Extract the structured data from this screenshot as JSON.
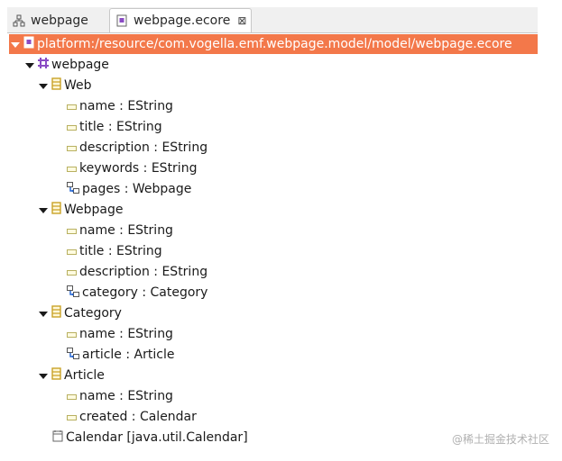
{
  "tabs": [
    {
      "label": "webpage"
    },
    {
      "label": "webpage.ecore",
      "close": "⊠"
    }
  ],
  "tree": {
    "root_path": "platform:/resource/com.vogella.emf.webpage.model/model/webpage.ecore",
    "package": "webpage",
    "classes": [
      {
        "name": "Web",
        "features": [
          {
            "label": "name : EString",
            "kind": "attribute"
          },
          {
            "label": "title : EString",
            "kind": "attribute"
          },
          {
            "label": "description : EString",
            "kind": "attribute"
          },
          {
            "label": "keywords : EString",
            "kind": "attribute"
          },
          {
            "label": "pages : Webpage",
            "kind": "reference"
          }
        ]
      },
      {
        "name": "Webpage",
        "features": [
          {
            "label": "name : EString",
            "kind": "attribute"
          },
          {
            "label": "title : EString",
            "kind": "attribute"
          },
          {
            "label": "description : EString",
            "kind": "attribute"
          },
          {
            "label": "category : Category",
            "kind": "reference"
          }
        ]
      },
      {
        "name": "Category",
        "features": [
          {
            "label": "name : EString",
            "kind": "attribute"
          },
          {
            "label": "article : Article",
            "kind": "reference"
          }
        ]
      },
      {
        "name": "Article",
        "features": [
          {
            "label": "name : EString",
            "kind": "attribute"
          },
          {
            "label": "created : Calendar",
            "kind": "attribute"
          }
        ]
      }
    ],
    "datatype": "Calendar [java.util.Calendar]"
  },
  "watermark": "@稀土掘金技术社区",
  "colors": {
    "selection": "#f3784a",
    "class_icon": "#c9a227",
    "attribute_icon": "#b8b060",
    "package_icon": "#8a4bc4"
  }
}
